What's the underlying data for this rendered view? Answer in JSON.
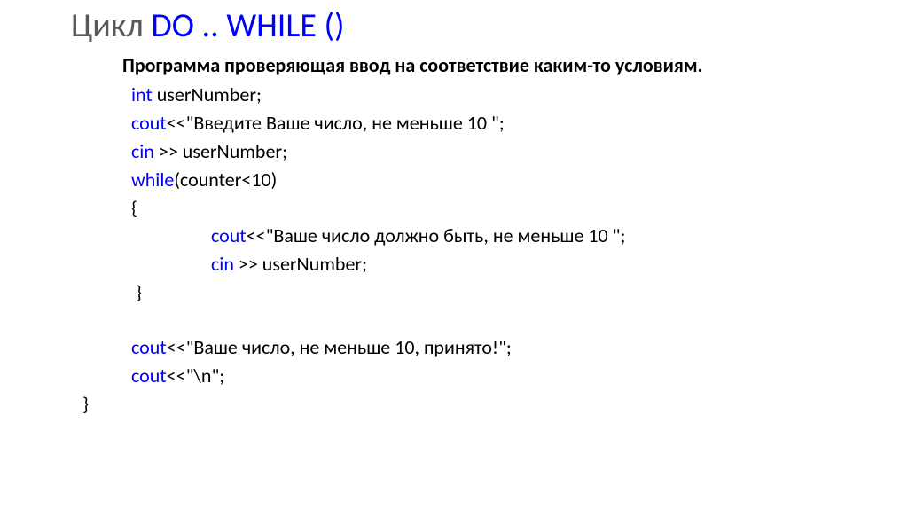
{
  "title": {
    "prefix": "Цикл ",
    "keyword": "DO ..  WHILE ()"
  },
  "subtitle": "Программа проверяющая ввод на соответствие каким-то условиям.",
  "code": {
    "line1_kw": "int ",
    "line1_txt": "userNumber;",
    "line2_kw": "cout",
    "line2_txt": "<<\"Введите Ваше число, не меньше 10 \";",
    "line3_kw": "cin ",
    "line3_txt": ">> userNumber;",
    "line4_kw": "while",
    "line4_txt": "(counter<10)",
    "line5": "{",
    "line6_kw": "cout",
    "line6_txt": "<<\"Ваше число должно быть, не меньше 10 \";",
    "line7_kw": "cin ",
    "line7_txt": ">> userNumber;",
    "line8": " }",
    "line9_kw": "cout",
    "line9_txt": "<<\"Ваше число, не меньше 10, принято!\";",
    "line10_kw": "cout",
    "line10_txt": "<<\"\\n\";",
    "line11": "}"
  }
}
